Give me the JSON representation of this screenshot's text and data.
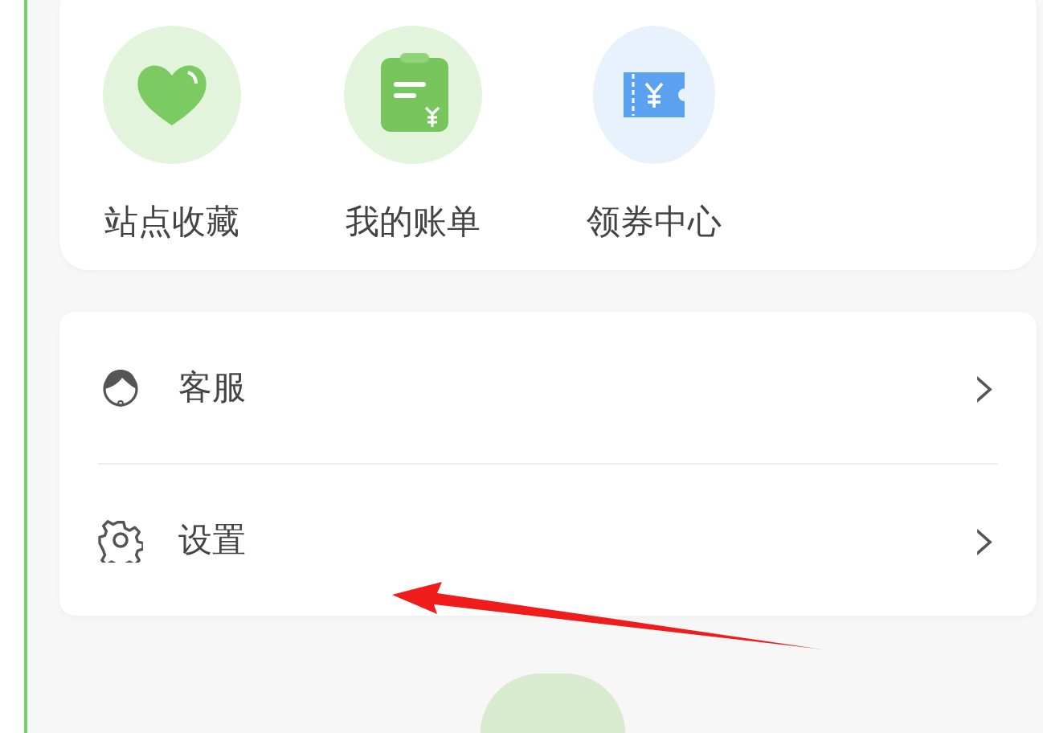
{
  "shortcuts": [
    {
      "kind": "heart",
      "label": "站点收藏"
    },
    {
      "kind": "bill",
      "label": "我的账单"
    },
    {
      "kind": "ticket",
      "label": "领券中心"
    }
  ],
  "menu": [
    {
      "kind": "support",
      "label": "客服",
      "chevron": "›"
    },
    {
      "kind": "settings",
      "label": "设置",
      "chevron": "›"
    }
  ]
}
